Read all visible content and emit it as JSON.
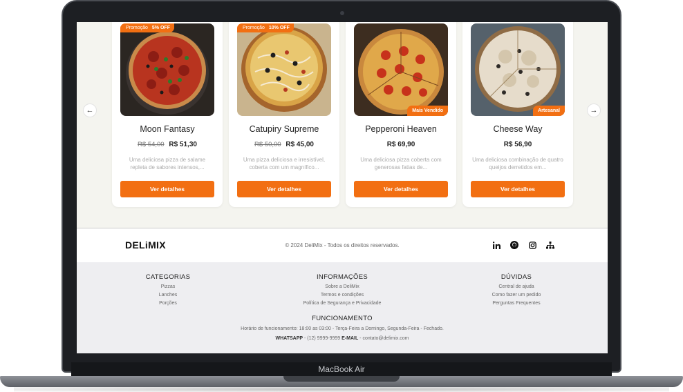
{
  "device": {
    "model": "MacBook Air"
  },
  "carousel": {
    "prev_icon": "chevron-left-icon",
    "next_icon": "chevron-right-icon",
    "prev_glyph": "←",
    "next_glyph": "→"
  },
  "products": [
    {
      "promo_label": "Promoção",
      "promo_value": "5% OFF",
      "tag": "",
      "name": "Moon Fantasy",
      "price_old": "R$ 54,00",
      "price": "R$ 51,30",
      "description": "Uma deliciosa pizza de salame repleta de sabores intensos,...",
      "button": "Ver detalhes"
    },
    {
      "promo_label": "Promoção",
      "promo_value": "10% OFF",
      "tag": "",
      "name": "Catupiry Supreme",
      "price_old": "R$ 50,00",
      "price": "R$ 45,00",
      "description": "Uma pizza deliciosa e irresistível, coberta com um magnífico...",
      "button": "Ver detalhes"
    },
    {
      "promo_label": "",
      "promo_value": "",
      "tag": "Mais Vendido",
      "name": "Pepperoni Heaven",
      "price_old": "",
      "price": "R$ 69,90",
      "description": "Uma deliciosa pizza coberta com generosas fatias de...",
      "button": "Ver detalhes"
    },
    {
      "promo_label": "",
      "promo_value": "",
      "tag": "Artesanal",
      "name": "Cheese Way",
      "price_old": "",
      "price": "R$ 56,90",
      "description": "Uma deliciosa combinação de quatro queijos derretidos em...",
      "button": "Ver detalhes"
    }
  ],
  "footer": {
    "logo": "DELiMIX",
    "copyright": "© 2024 DeliMix - Todos os direitos reservados.",
    "social_icons": [
      "linkedin-icon",
      "github-icon",
      "instagram-icon",
      "sitemap-icon"
    ],
    "columns": [
      {
        "title": "CATEGORIAS",
        "links": [
          "Pizzas",
          "Lanches",
          "Porções"
        ]
      },
      {
        "title": "INFORMAÇÕES",
        "links": [
          "Sobre a DeliMix",
          "Termos e condições",
          "Política de Segurança e Privacidade"
        ]
      },
      {
        "title": "DÚVIDAS",
        "links": [
          "Central de ajuda",
          "Como fazer um pedido",
          "Perguntas Frequentes"
        ]
      }
    ],
    "hours_title": "FUNCIONAMENTO",
    "hours_text": "Horário de funcionamento: 18:00 as 03:00 - Terça-Feira a Domingo, Segunda-Feira - Fechado.",
    "whatsapp_label": "WHATSAPP",
    "whatsapp_value": "(12) 9999-9999",
    "email_label": "E-MAIL",
    "email_value": "contato@delimix.com"
  },
  "colors": {
    "accent": "#f26f12",
    "page_bg": "#f4f4ef",
    "footer_bg": "#eeeef1"
  }
}
